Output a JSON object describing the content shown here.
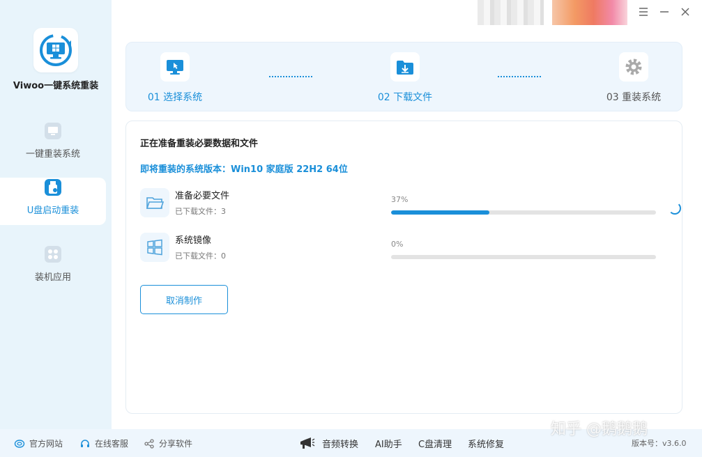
{
  "app": {
    "title": "Viwoo一键系统重装"
  },
  "colors": {
    "accent": "#1a8fd9",
    "sidebar_bg": "#e8f4fb",
    "footer_bg": "#eef6fd"
  },
  "sidebar": {
    "items": [
      {
        "label": "一键重装系统",
        "icon": "monitor-reinstall-icon",
        "active": false
      },
      {
        "label": "U盘启动重装",
        "icon": "usb-drive-icon",
        "active": true
      },
      {
        "label": "装机应用",
        "icon": "apps-grid-icon",
        "active": false
      }
    ]
  },
  "window_controls": {
    "menu": "menu-icon",
    "minimize": "minimize-icon",
    "close": "close-icon"
  },
  "steps": [
    {
      "label": "01 选择系统",
      "icon": "monitor-cursor-icon",
      "state": "done"
    },
    {
      "label": "02 下载文件",
      "icon": "download-folder-icon",
      "state": "current"
    },
    {
      "label": "03 重装系统",
      "icon": "gear-icon",
      "state": "todo"
    }
  ],
  "main": {
    "title": "正在准备重装必要数据和文件",
    "version_line": "即将重装的系统版本：Win10 家庭版 22H2 64位",
    "tasks": [
      {
        "name": "准备必要文件",
        "sub": "已下载文件：3",
        "percent_text": "37%",
        "progress": 0.37,
        "icon": "folder-icon"
      },
      {
        "name": "系统镜像",
        "sub": "已下载文件：0",
        "percent_text": "0%",
        "progress": 0,
        "icon": "windows-logo-icon"
      }
    ],
    "cancel_label": "取消制作"
  },
  "footer": {
    "links": [
      {
        "label": "官方网站",
        "icon": "globe-icon"
      },
      {
        "label": "在线客服",
        "icon": "headset-icon"
      },
      {
        "label": "分享软件",
        "icon": "share-icon"
      }
    ],
    "tools": [
      "音频转换",
      "AI助手",
      "C盘清理",
      "系统修复"
    ],
    "tools_icon": "megaphone-icon",
    "watermark": "知乎 @鹅鹅鹅",
    "version": "版本号：v3.6.0"
  }
}
